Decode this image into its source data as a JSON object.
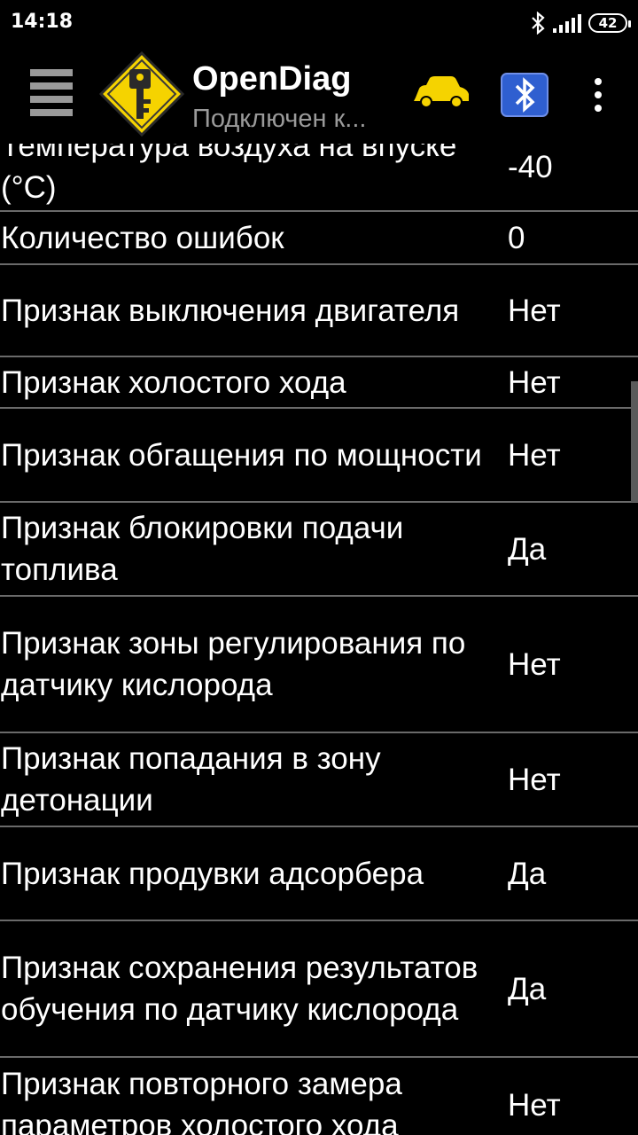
{
  "status": {
    "time": "14:18",
    "battery": "42"
  },
  "toolbar": {
    "title": "OpenDiag",
    "subtitle": "Подключен к..."
  },
  "rows": [
    {
      "label": "Температура воздуха на впуске (°C)",
      "value": "-40"
    },
    {
      "label": "Количество ошибок",
      "value": "0"
    },
    {
      "label": "Признак выключения двигателя",
      "value": "Нет"
    },
    {
      "label": "Признак холостого хода",
      "value": "Нет"
    },
    {
      "label": "Признак обгащения по мощности",
      "value": "Нет"
    },
    {
      "label": "Признак блокировки подачи топлива",
      "value": "Да"
    },
    {
      "label": "Признак зоны регулирования по датчику кислорода",
      "value": "Нет"
    },
    {
      "label": "Признак попадания в зону детонации",
      "value": "Нет"
    },
    {
      "label": "Признак продувки адсорбера",
      "value": "Да"
    },
    {
      "label": "Признак сохранения результатов обучения по датчику кислорода",
      "value": "Да"
    },
    {
      "label": "Признак повторного замера параметров холостого хода",
      "value": "Нет"
    }
  ],
  "colors": {
    "background": "#000000",
    "divider": "#6a6a6a",
    "car": "#f5d300",
    "bluetooth": "#2f5fd0",
    "subtitle": "#9a9a9a"
  },
  "icons": [
    "menu-icon",
    "app-key-logo-icon",
    "car-icon",
    "bluetooth-elm327-icon",
    "more-vert-icon",
    "bluetooth-status-icon",
    "signal-icon",
    "battery-icon"
  ]
}
